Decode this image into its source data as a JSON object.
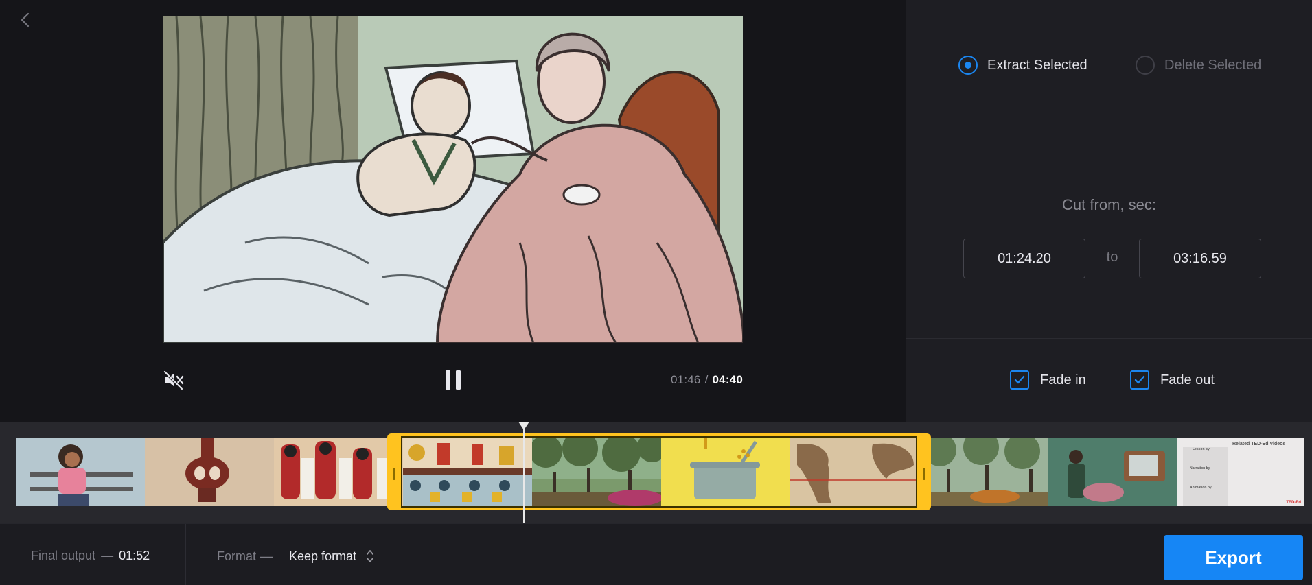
{
  "colors": {
    "accent": "#1686f5",
    "selection": "#ffc31f",
    "background": "#151519",
    "panel": "#1e1e23"
  },
  "nav": {
    "back_icon": "chevron-left-icon"
  },
  "player": {
    "mute_icon": "volume-muted-icon",
    "pause_icon": "pause-icon",
    "time_current": "01:46",
    "time_separator": "/",
    "time_total": "04:40",
    "playhead_fraction": 0.379
  },
  "cut_mode": {
    "options": [
      {
        "label": "Extract Selected",
        "selected": true
      },
      {
        "label": "Delete Selected",
        "selected": false
      }
    ]
  },
  "cut_range": {
    "title": "Cut from, sec:",
    "from": "01:24.20",
    "to_label": "to",
    "to": "03:16.59"
  },
  "fade": {
    "fade_in": {
      "label": "Fade in",
      "checked": true
    },
    "fade_out": {
      "label": "Fade out",
      "checked": true
    }
  },
  "timeline": {
    "thumbnail_count": 10,
    "selection_start_fraction": 0.3,
    "selection_end_fraction": 0.7,
    "end_card_title": "Related TED-Ed Videos",
    "end_card_lines": [
      "Lesson by",
      "Narration by",
      "Animation by"
    ],
    "end_card_badge": "TED-Ed"
  },
  "bottom_bar": {
    "final_output_label": "Final output",
    "final_output_dash": "—",
    "final_output_value": "01:52",
    "format_label": "Format",
    "format_dash": "—",
    "format_value": "Keep format",
    "format_icon": "sort-arrows-icon",
    "export_label": "Export"
  }
}
